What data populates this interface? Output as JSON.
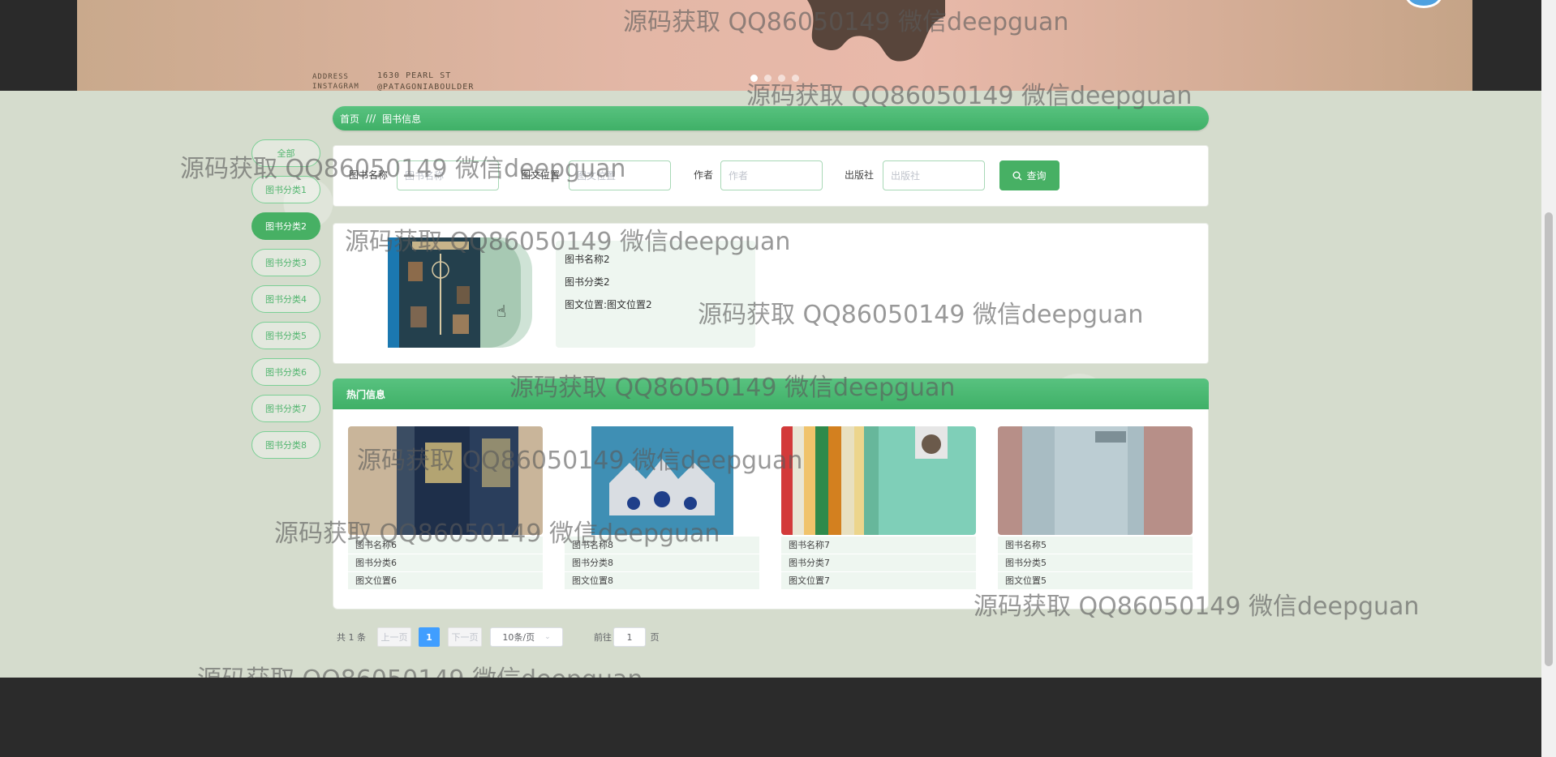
{
  "hero": {
    "address_label": "ADDRESS",
    "address_value": "1630 PEARL ST",
    "instagram_label": "INSTAGRAM",
    "instagram_value": "@PATAGONIABOULDER",
    "slide_count": 4,
    "active_slide": 1
  },
  "breadcrumb": {
    "home": "首页",
    "separator": "///",
    "current": "图书信息"
  },
  "categories": [
    {
      "label": "全部",
      "active": false
    },
    {
      "label": "图书分类1",
      "active": false
    },
    {
      "label": "图书分类2",
      "active": true
    },
    {
      "label": "图书分类3",
      "active": false
    },
    {
      "label": "图书分类4",
      "active": false
    },
    {
      "label": "图书分类5",
      "active": false
    },
    {
      "label": "图书分类6",
      "active": false
    },
    {
      "label": "图书分类7",
      "active": false
    },
    {
      "label": "图书分类8",
      "active": false
    }
  ],
  "search": {
    "name_label": "图书名称",
    "name_placeholder": "图书名称",
    "location_label": "图文位置",
    "location_placeholder": "图文位置",
    "author_label": "作者",
    "author_placeholder": "作者",
    "publisher_label": "出版社",
    "publisher_placeholder": "出版社",
    "button_label": "查询"
  },
  "detail": {
    "name": "图书名称2",
    "category": "图书分类2",
    "location": "图文位置:图文位置2"
  },
  "hot": {
    "title": "热门信息",
    "items": [
      {
        "name": "图书名称6",
        "category": "图书分类6",
        "location": "图文位置6"
      },
      {
        "name": "图书名称8",
        "category": "图书分类8",
        "location": "图文位置8"
      },
      {
        "name": "图书名称7",
        "category": "图书分类7",
        "location": "图文位置7"
      },
      {
        "name": "图书名称5",
        "category": "图书分类5",
        "location": "图文位置5"
      }
    ]
  },
  "pagination": {
    "total": "共 1 条",
    "prev": "上一页",
    "current_page": "1",
    "next": "下一页",
    "page_size": "10条/页",
    "goto_label": "前往",
    "goto_value": "1",
    "page_suffix": "页"
  },
  "watermark": "源码获取 QQ86050149 微信deepguan",
  "colors": {
    "accent": "#47b064",
    "page_bg": "#d5dccd",
    "pager_active": "#409eff"
  }
}
